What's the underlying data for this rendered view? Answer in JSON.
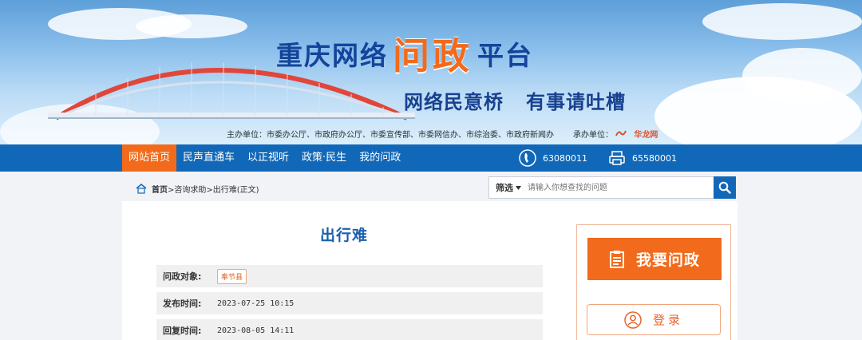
{
  "banner": {
    "title_prefix": "重庆网络",
    "title_accent": "问政",
    "title_suffix": "平台",
    "slogan_left": "网络民意桥",
    "slogan_right": "有事请吐槽",
    "sponsors": "主办单位：市委办公厅、市政府办公厅、市委宣传部、市委网信办、市综治委、市政府新闻办",
    "organizer_label": "承办单位：",
    "organizer_name": "华龙网"
  },
  "nav": {
    "items": [
      {
        "label": "网站首页",
        "active": true
      },
      {
        "label": "民声直通车",
        "active": false
      },
      {
        "label": "以正视听",
        "active": false
      },
      {
        "label": "政策·民生",
        "active": false
      },
      {
        "label": "我的问政",
        "active": false
      }
    ],
    "phone1": "63080011",
    "phone2": "65580001"
  },
  "breadcrumb": {
    "home": "首页",
    "path": ">咨询求助>出行难(正文)"
  },
  "search": {
    "filter_label": "筛选",
    "placeholder": "请输入你想查找的问题"
  },
  "article": {
    "title": "出行难",
    "target_label": "问政对象:",
    "target_value": "奉节县",
    "publish_label": "发布时间:",
    "publish_value": "2023-07-25 10:15",
    "reply_label": "回复时间:",
    "reply_value": "2023-08-05 14:11"
  },
  "sidebar": {
    "ask_label": "我要问政",
    "login_label": "登录"
  },
  "colors": {
    "nav_blue": "#1268b8",
    "accent_orange": "#f26a1b",
    "title_blue": "#1a5fad"
  }
}
